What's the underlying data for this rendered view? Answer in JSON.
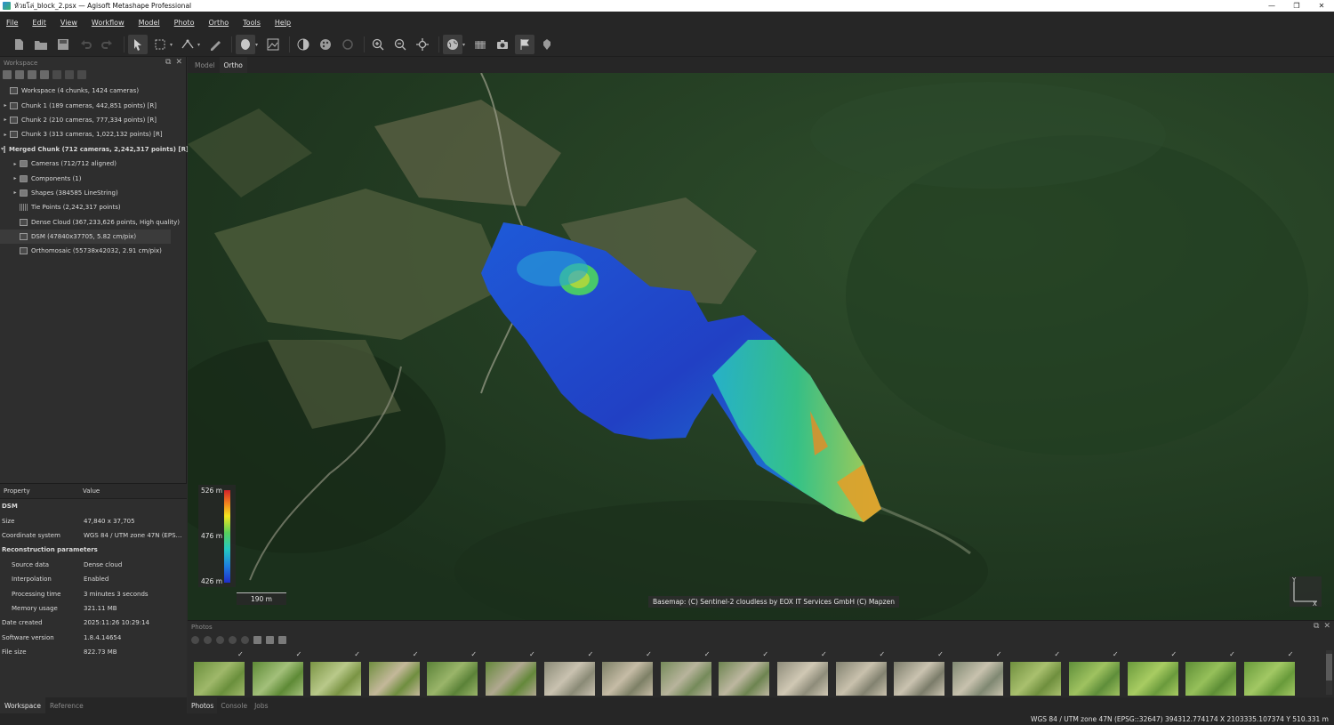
{
  "window": {
    "title": "ห้วยโล่_block_2.psx — Agisoft Metashape Professional",
    "controls": [
      "—",
      "❐",
      "✕"
    ]
  },
  "menu": [
    "File",
    "Edit",
    "View",
    "Workflow",
    "Model",
    "Photo",
    "Ortho",
    "Tools",
    "Help"
  ],
  "toolbar": {
    "icons": [
      "new-document-icon",
      "open-folder-icon",
      "save-icon",
      "undo-icon",
      "redo-icon",
      "navigate-arrow-icon",
      "rectangle-selection-icon",
      "ruler-tool-icon",
      "draw-polyline-icon",
      "dsm-view-icon",
      "orthomosaic-view-icon",
      "contrast-icon",
      "palette-icon",
      "rotate-icon",
      "zoom-in-icon",
      "zoom-out-icon",
      "reset-view-icon",
      "globe-icon",
      "grid-icon",
      "camera-icon",
      "flag-icon",
      "markers-icon"
    ]
  },
  "workspace": {
    "header": "Workspace",
    "tree": [
      {
        "label": "Workspace (4 chunks, 1424 cameras)",
        "level": 0,
        "icon": "workspace-icon",
        "arrow": ""
      },
      {
        "label": "Chunk 1 (189 cameras, 442,851 points) [R]",
        "level": 0,
        "icon": "chunk-icon",
        "arrow": "▸"
      },
      {
        "label": "Chunk 2 (210 cameras, 777,334 points) [R]",
        "level": 0,
        "icon": "chunk-icon",
        "arrow": "▸"
      },
      {
        "label": "Chunk 3 (313 cameras, 1,022,132 points) [R]",
        "level": 0,
        "icon": "chunk-icon",
        "arrow": "▸"
      },
      {
        "label": "Merged Chunk (712 cameras, 2,242,317 points) [R]",
        "level": 0,
        "icon": "chunk-icon",
        "arrow": "▾",
        "bold": true
      },
      {
        "label": "Cameras (712/712 aligned)",
        "level": 1,
        "icon": "folder-icon",
        "arrow": "▸"
      },
      {
        "label": "Components (1)",
        "level": 1,
        "icon": "folder-icon",
        "arrow": "▸"
      },
      {
        "label": "Shapes (384585 LineString)",
        "level": 1,
        "icon": "folder-icon",
        "arrow": "▸"
      },
      {
        "label": "Tie Points (2,242,317 points)",
        "level": 1,
        "icon": "tie-points-icon",
        "arrow": ""
      },
      {
        "label": "Dense Cloud (367,233,626 points, High quality)",
        "level": 1,
        "icon": "dense-cloud-icon",
        "arrow": ""
      },
      {
        "label": "DSM (47840x37705, 5.82 cm/pix)",
        "level": 1,
        "icon": "dsm-icon",
        "arrow": "",
        "selected": true
      },
      {
        "label": "Orthomosaic (55738x42032, 2.91 cm/pix)",
        "level": 1,
        "icon": "orthomosaic-icon",
        "arrow": ""
      }
    ]
  },
  "properties": {
    "col_property": "Property",
    "col_value": "Value",
    "rows": [
      {
        "k": "DSM",
        "v": "",
        "section": true
      },
      {
        "k": "Size",
        "v": "47,840 x 37,705"
      },
      {
        "k": "Coordinate system",
        "v": "WGS 84 / UTM zone 47N (EPSG::32..."
      },
      {
        "k": "Reconstruction parameters",
        "v": "",
        "section": true
      },
      {
        "k": "Source data",
        "v": "Dense cloud",
        "indent": true
      },
      {
        "k": "Interpolation",
        "v": "Enabled",
        "indent": true
      },
      {
        "k": "Processing time",
        "v": "3 minutes 3 seconds",
        "indent": true
      },
      {
        "k": "Memory usage",
        "v": "321.11 MB",
        "indent": true
      },
      {
        "k": "Date created",
        "v": "2025:11:26 10:29:14"
      },
      {
        "k": "Software version",
        "v": "1.8.4.14654"
      },
      {
        "k": "File size",
        "v": "822.73 MB"
      }
    ]
  },
  "left_tabs": {
    "workspace": "Workspace",
    "reference": "Reference"
  },
  "view_tabs": {
    "model": "Model",
    "ortho": "Ortho"
  },
  "legend": {
    "max": "526 m",
    "mid": "476 m",
    "min": "426 m"
  },
  "scale": "190 m",
  "basemap_credit": "Basemap: (C) Sentinel-2 cloudless by EOX IT Services GmbH (C) Mapzen",
  "axis": {
    "y": "Y",
    "x": "X"
  },
  "photos": {
    "header": "Photos",
    "count": 19,
    "check": "✓"
  },
  "bottom_tabs": {
    "photos": "Photos",
    "console": "Console",
    "jobs": "Jobs"
  },
  "status": "WGS 84 / UTM zone 47N (EPSG::32647)   394312.774174 X   2103335.107374 Y   510.331 m"
}
